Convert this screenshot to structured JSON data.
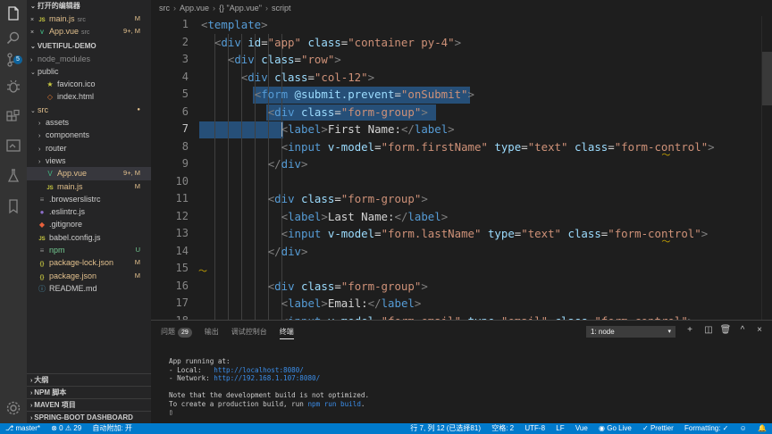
{
  "sidebar": {
    "open_editors_title": "打开的编辑器",
    "open_editors": [
      {
        "name": "main.js",
        "extra": "src",
        "badge": "M",
        "icon": "js-icon"
      },
      {
        "name": "App.vue",
        "extra": "src",
        "badge": "9+, M",
        "icon": "vue-icon"
      }
    ],
    "project_title": "VUETIFUL-DEMO",
    "tree": [
      {
        "name": "node_modules",
        "indent": 1,
        "chevron": "›",
        "icon": "",
        "badge": "",
        "dim": true
      },
      {
        "name": "public",
        "indent": 1,
        "chevron": "⌄",
        "icon": "",
        "badge": ""
      },
      {
        "name": "favicon.ico",
        "indent": 2,
        "chevron": "",
        "icon": "★",
        "badge": ""
      },
      {
        "name": "index.html",
        "indent": 2,
        "chevron": "",
        "icon": "◇",
        "badge": ""
      },
      {
        "name": "src",
        "indent": 1,
        "chevron": "⌄",
        "icon": "",
        "badge": "●",
        "mod": true
      },
      {
        "name": "assets",
        "indent": 2,
        "chevron": "›",
        "icon": "",
        "badge": ""
      },
      {
        "name": "components",
        "indent": 2,
        "chevron": "›",
        "icon": "",
        "badge": ""
      },
      {
        "name": "router",
        "indent": 2,
        "chevron": "›",
        "icon": "",
        "badge": ""
      },
      {
        "name": "views",
        "indent": 2,
        "chevron": "›",
        "icon": "",
        "badge": ""
      },
      {
        "name": "App.vue",
        "indent": 2,
        "chevron": "",
        "icon": "V",
        "badge": "9+, M",
        "mod": true,
        "active": true
      },
      {
        "name": "main.js",
        "indent": 2,
        "chevron": "",
        "icon": "JS",
        "badge": "M",
        "mod": true
      },
      {
        "name": ".browserslistrc",
        "indent": 1,
        "chevron": "",
        "icon": "≡",
        "badge": ""
      },
      {
        "name": ".eslintrc.js",
        "indent": 1,
        "chevron": "",
        "icon": "●",
        "badge": ""
      },
      {
        "name": ".gitignore",
        "indent": 1,
        "chevron": "",
        "icon": "◆",
        "badge": ""
      },
      {
        "name": "babel.config.js",
        "indent": 1,
        "chevron": "",
        "icon": "JS",
        "badge": ""
      },
      {
        "name": "npm",
        "indent": 1,
        "chevron": "",
        "icon": "≡",
        "badge": "U",
        "untracked": true
      },
      {
        "name": "package-lock.json",
        "indent": 1,
        "chevron": "",
        "icon": "{}",
        "badge": "M",
        "mod": true
      },
      {
        "name": "package.json",
        "indent": 1,
        "chevron": "",
        "icon": "{}",
        "badge": "M",
        "mod": true
      },
      {
        "name": "README.md",
        "indent": 1,
        "chevron": "",
        "icon": "ⓘ",
        "badge": ""
      }
    ],
    "bottom_sections": [
      "大纲",
      "NPM 脚本",
      "MAVEN 项目",
      "SPRING-BOOT DASHBOARD"
    ]
  },
  "breadcrumb": [
    "src",
    "App.vue",
    "{} \"App.vue\"",
    "script"
  ],
  "editor": {
    "first_line": 1,
    "lines": [
      {
        "indent": 0,
        "tokens": [
          [
            "br",
            "<"
          ],
          [
            "tag",
            "template"
          ],
          [
            "br",
            ">"
          ]
        ]
      },
      {
        "indent": 1,
        "tokens": [
          [
            "br",
            "<"
          ],
          [
            "tag",
            "div"
          ],
          [
            "txt",
            " "
          ],
          [
            "attr",
            "id"
          ],
          [
            "txt",
            "="
          ],
          [
            "str",
            "\"app\""
          ],
          [
            "txt",
            " "
          ],
          [
            "attr",
            "class"
          ],
          [
            "txt",
            "="
          ],
          [
            "str",
            "\"container py-4\""
          ],
          [
            "br",
            ">"
          ]
        ]
      },
      {
        "indent": 2,
        "tokens": [
          [
            "br",
            "<"
          ],
          [
            "tag",
            "div"
          ],
          [
            "txt",
            " "
          ],
          [
            "attr",
            "class"
          ],
          [
            "txt",
            "="
          ],
          [
            "str",
            "\"row\""
          ],
          [
            "br",
            ">"
          ]
        ]
      },
      {
        "indent": 3,
        "tokens": [
          [
            "br",
            "<"
          ],
          [
            "tag",
            "div"
          ],
          [
            "txt",
            " "
          ],
          [
            "attr",
            "class"
          ],
          [
            "txt",
            "="
          ],
          [
            "str",
            "\"col-12\""
          ],
          [
            "br",
            ">"
          ]
        ]
      },
      {
        "indent": 4,
        "tokens": [
          [
            "br",
            "<"
          ],
          [
            "tag",
            "form"
          ],
          [
            "txt",
            " "
          ],
          [
            "attr",
            "@submit.prevent"
          ],
          [
            "txt",
            "="
          ],
          [
            "str",
            "\"onSubmit\""
          ],
          [
            "br",
            ">"
          ]
        ]
      },
      {
        "indent": 5,
        "tokens": [
          [
            "br",
            "<"
          ],
          [
            "tag",
            "div"
          ],
          [
            "txt",
            " "
          ],
          [
            "attr",
            "class"
          ],
          [
            "txt",
            "="
          ],
          [
            "str",
            "\"form-group\""
          ],
          [
            "br",
            ">"
          ]
        ]
      },
      {
        "indent": 6,
        "tokens": [
          [
            "br",
            "<"
          ],
          [
            "tag",
            "label"
          ],
          [
            "br",
            ">"
          ],
          [
            "txt",
            "First Name:"
          ],
          [
            "br",
            "</"
          ],
          [
            "tag",
            "label"
          ],
          [
            "br",
            ">"
          ]
        ]
      },
      {
        "indent": 6,
        "tokens": [
          [
            "br",
            "<"
          ],
          [
            "tag",
            "input"
          ],
          [
            "txt",
            " "
          ],
          [
            "attr",
            "v-model"
          ],
          [
            "txt",
            "="
          ],
          [
            "str",
            "\"form.firstName\""
          ],
          [
            "txt",
            " "
          ],
          [
            "attr",
            "type"
          ],
          [
            "txt",
            "="
          ],
          [
            "str",
            "\"text\""
          ],
          [
            "txt",
            " "
          ],
          [
            "attr",
            "class"
          ],
          [
            "txt",
            "="
          ],
          [
            "str",
            "\"form-control\""
          ],
          [
            "br",
            ">"
          ]
        ]
      },
      {
        "indent": 5,
        "tokens": [
          [
            "br",
            "</"
          ],
          [
            "tag",
            "div"
          ],
          [
            "br",
            ">"
          ]
        ]
      },
      {
        "indent": 0,
        "tokens": []
      },
      {
        "indent": 5,
        "tokens": [
          [
            "br",
            "<"
          ],
          [
            "tag",
            "div"
          ],
          [
            "txt",
            " "
          ],
          [
            "attr",
            "class"
          ],
          [
            "txt",
            "="
          ],
          [
            "str",
            "\"form-group\""
          ],
          [
            "br",
            ">"
          ]
        ]
      },
      {
        "indent": 6,
        "tokens": [
          [
            "br",
            "<"
          ],
          [
            "tag",
            "label"
          ],
          [
            "br",
            ">"
          ],
          [
            "txt",
            "Last Name:"
          ],
          [
            "br",
            "</"
          ],
          [
            "tag",
            "label"
          ],
          [
            "br",
            ">"
          ]
        ]
      },
      {
        "indent": 6,
        "tokens": [
          [
            "br",
            "<"
          ],
          [
            "tag",
            "input"
          ],
          [
            "txt",
            " "
          ],
          [
            "attr",
            "v-model"
          ],
          [
            "txt",
            "="
          ],
          [
            "str",
            "\"form.lastName\""
          ],
          [
            "txt",
            " "
          ],
          [
            "attr",
            "type"
          ],
          [
            "txt",
            "="
          ],
          [
            "str",
            "\"text\""
          ],
          [
            "txt",
            " "
          ],
          [
            "attr",
            "class"
          ],
          [
            "txt",
            "="
          ],
          [
            "str",
            "\"form-control\""
          ],
          [
            "br",
            ">"
          ]
        ]
      },
      {
        "indent": 5,
        "tokens": [
          [
            "br",
            "</"
          ],
          [
            "tag",
            "div"
          ],
          [
            "br",
            ">"
          ]
        ]
      },
      {
        "indent": 0,
        "tokens": []
      },
      {
        "indent": 5,
        "tokens": [
          [
            "br",
            "<"
          ],
          [
            "tag",
            "div"
          ],
          [
            "txt",
            " "
          ],
          [
            "attr",
            "class"
          ],
          [
            "txt",
            "="
          ],
          [
            "str",
            "\"form-group\""
          ],
          [
            "br",
            ">"
          ]
        ]
      },
      {
        "indent": 6,
        "tokens": [
          [
            "br",
            "<"
          ],
          [
            "tag",
            "label"
          ],
          [
            "br",
            ">"
          ],
          [
            "txt",
            "Email:"
          ],
          [
            "br",
            "</"
          ],
          [
            "tag",
            "label"
          ],
          [
            "br",
            ">"
          ]
        ]
      },
      {
        "indent": 6,
        "tokens": [
          [
            "br",
            "<"
          ],
          [
            "tag",
            "input"
          ],
          [
            "txt",
            " "
          ],
          [
            "attr",
            "v-model"
          ],
          [
            "txt",
            "="
          ],
          [
            "str",
            "\"form.email\""
          ],
          [
            "txt",
            " "
          ],
          [
            "attr",
            "type"
          ],
          [
            "txt",
            "="
          ],
          [
            "str",
            "\"email\""
          ],
          [
            "txt",
            " "
          ],
          [
            "attr",
            "class"
          ],
          [
            "txt",
            "="
          ],
          [
            "str",
            "\"form-control\""
          ],
          [
            "br",
            ">"
          ]
        ]
      }
    ]
  },
  "panel": {
    "tabs": [
      {
        "label": "问题",
        "count": "29"
      },
      {
        "label": "输出",
        "count": ""
      },
      {
        "label": "调试控制台",
        "count": ""
      },
      {
        "label": "终端",
        "count": "",
        "active": true
      }
    ],
    "terminal_select": "1: node",
    "terminal": {
      "line1": "App running at:",
      "local_label": "- Local:   ",
      "local_url": "http://localhost:8080/",
      "network_label": "- Network: ",
      "network_url": "http://192.168.1.107:8080/",
      "note1": "Note that the development build is not optimized.",
      "note2_pre": "To create a production build, run ",
      "note2_cmd": "npm run build",
      "note2_post": ".",
      "prompt": "▯"
    }
  },
  "statusbar": {
    "branch": "master*",
    "problems": "⊗ 0 ⚠ 29",
    "auto_attach": "自动附加: 开",
    "position": "行 7, 列 12 (已选择81)",
    "spaces": "空格: 2",
    "encoding": "UTF-8",
    "eol": "LF",
    "language": "Vue",
    "golive": "Go Live",
    "prettier": "Prettier",
    "formatting": "Formatting: ✓"
  },
  "colors": {
    "accent": "#007acc",
    "selection": "#264f78",
    "modified": "#e2c08d",
    "untracked": "#73c991"
  }
}
